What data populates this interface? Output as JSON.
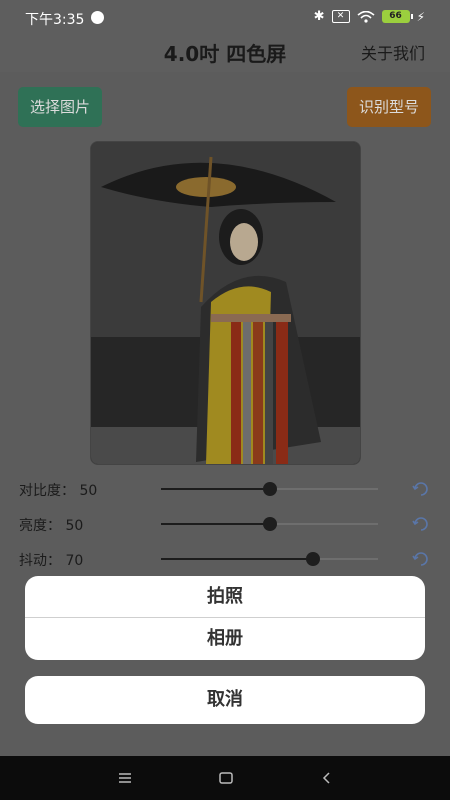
{
  "status_bar": {
    "time": "下午3:35",
    "battery": "66",
    "bluetooth_icon": "bluetooth-icon",
    "wifi_icon": "wifi-icon",
    "charging_icon": "bolt-icon"
  },
  "header": {
    "title": "4.0吋 四色屏",
    "about": "关于我们"
  },
  "toolbar": {
    "select_image": "选择图片",
    "identify_model": "识别型号",
    "select_color": "#2f7156",
    "identify_color": "#8d561b"
  },
  "image": {
    "description_icon": "photo"
  },
  "sliders": [
    {
      "label": "对比度：",
      "value": "50",
      "level": 0.5
    },
    {
      "label": "亮度：",
      "value": "50",
      "level": 0.5
    },
    {
      "label": "抖动：",
      "value": "70",
      "level": 0.7
    }
  ],
  "action_sheet": {
    "take_photo": "拍照",
    "album": "相册",
    "cancel": "取消"
  }
}
